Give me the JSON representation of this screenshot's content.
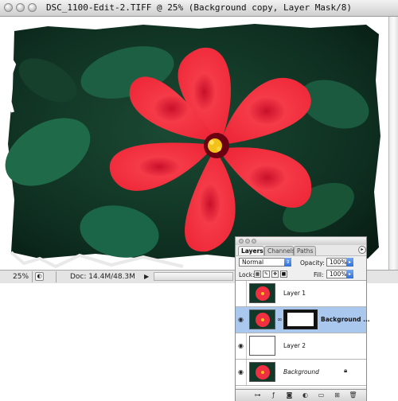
{
  "document": {
    "title": "DSC_1100-Edit-2.TIFF @ 25% (Background copy, Layer Mask/8)"
  },
  "status_bar": {
    "zoom": "25%",
    "doc_size": "Doc: 14.4M/48.3M"
  },
  "layers_panel": {
    "tabs": [
      "Layers",
      "Channels",
      "Paths"
    ],
    "active_tab": "Layers",
    "blend_mode": "Normal",
    "opacity_label": "Opacity:",
    "opacity_value": "100%",
    "lock_label": "Lock:",
    "fill_label": "Fill:",
    "fill_value": "100%",
    "layers": [
      {
        "name": "Layer 1",
        "visible": false,
        "selected": false
      },
      {
        "name": "Background ...",
        "visible": true,
        "selected": true
      },
      {
        "name": "Layer 2",
        "visible": true,
        "selected": false
      },
      {
        "name": "Background",
        "visible": true,
        "selected": false,
        "locked": true
      }
    ]
  },
  "colors": {
    "selection": "#aac8ee",
    "flower": "#f0303c",
    "foliage": "#1f5a3c"
  },
  "icons": [
    "eye-icon",
    "chain-link-icon",
    "lock-icon",
    "palette-menu-icon"
  ]
}
